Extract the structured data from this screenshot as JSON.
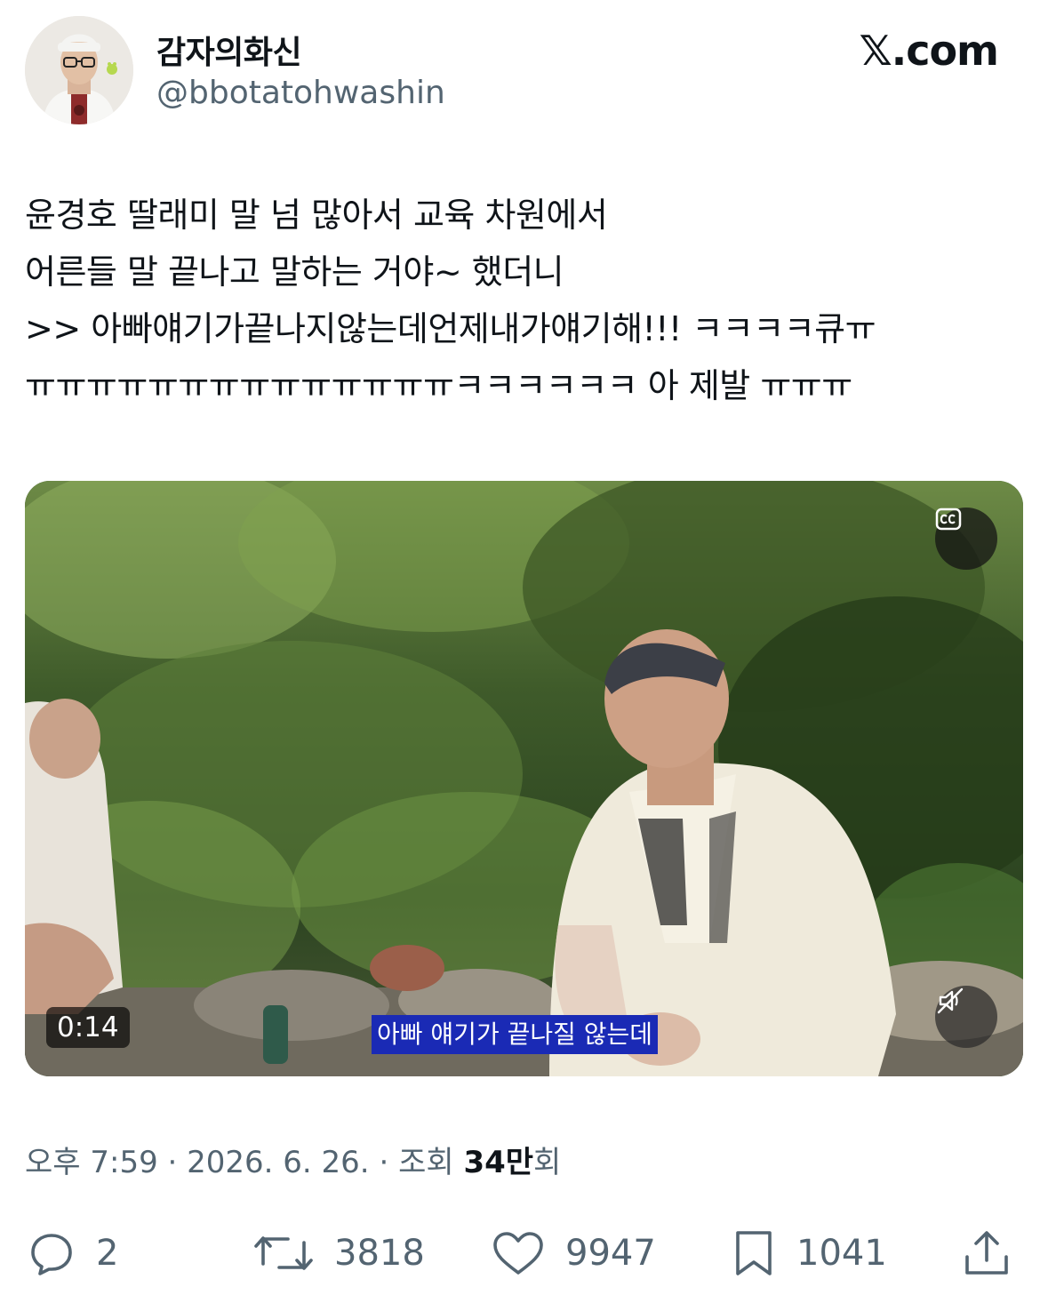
{
  "author": {
    "display_name": "감자의화신",
    "handle": "@bbotatohwashin"
  },
  "source_label": "𝕏.com",
  "tweet": {
    "lines": [
      "윤경호 딸래미 말 넘 많아서 교육 차원에서",
      "어른들 말 끝나고 말하는 거야~ 했더니",
      ">> 아빠얘기가끝나지않는데언제내가얘기해!!! ㅋㅋㅋㅋ큐ㅠ",
      "ㅠㅠㅠㅠㅠㅠㅠㅠㅠㅠㅠㅠㅠㅠㅋㅋㅋㅋㅋㅋ 아 제발 ㅠㅠㅠ"
    ]
  },
  "video": {
    "duration": "0:14",
    "subtitle": "아빠 얘기가 끝나질 않는데",
    "cc_icon": "closed-captions-icon",
    "mute_icon": "speaker-muted-icon"
  },
  "meta": {
    "time": "오후 7:59",
    "date": "2026. 6. 26.",
    "views_prefix": "조회",
    "views_count": "34만",
    "views_suffix": "회"
  },
  "actions": {
    "replies": "2",
    "reposts": "3818",
    "likes": "9947",
    "bookmarks": "1041"
  },
  "colors": {
    "text_primary": "#0f1419",
    "text_secondary": "#536471",
    "subtitle_bg": "#1a2ab5"
  }
}
